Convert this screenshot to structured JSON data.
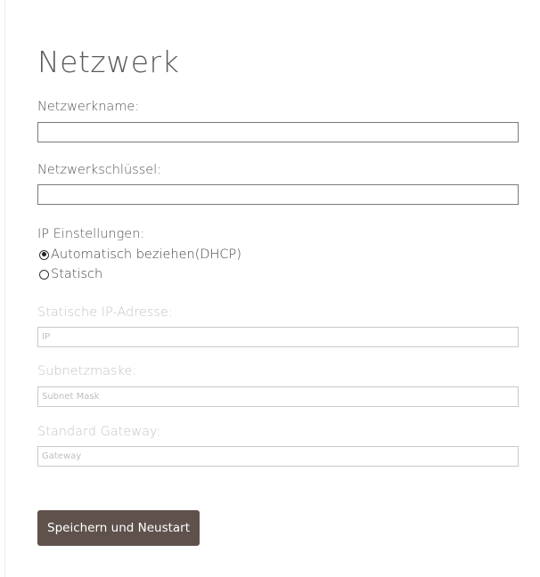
{
  "form": {
    "title": "Netzwerk",
    "network_name": {
      "label": "Netzwerkname:",
      "value": "",
      "placeholder": ""
    },
    "network_key": {
      "label": "Netzwerkschlüssel:",
      "value": "",
      "placeholder": ""
    },
    "ip_settings": {
      "label": "IP Einstellungen:",
      "options": [
        {
          "label": "Automatisch beziehen(DHCP)",
          "checked": true
        },
        {
          "label": "Statisch",
          "checked": false
        }
      ]
    },
    "static_ip": {
      "label": "Statische IP-Adresse:",
      "placeholder": "IP",
      "value": ""
    },
    "subnet_mask": {
      "label": "Subnetzmaske:",
      "placeholder": "Subnet Mask",
      "value": ""
    },
    "gateway": {
      "label": "Standard Gateway:",
      "placeholder": "Gateway",
      "value": ""
    },
    "save_label": "Speichern und Neustart"
  }
}
